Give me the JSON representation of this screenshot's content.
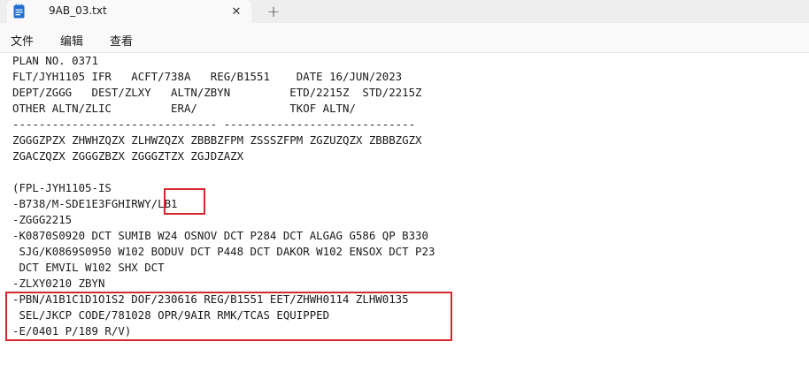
{
  "tab": {
    "title": "9AB_03.txt",
    "close_label": "✕",
    "new_tab_label": "+"
  },
  "menu": {
    "file": "文件",
    "edit": "编辑",
    "view": "查看"
  },
  "editor": {
    "lines": [
      "PLAN NO. 0371",
      "FLT/JYH1105 IFR   ACFT/738A   REG/B1551    DATE 16/JUN/2023",
      "DEPT/ZGGG   DEST/ZLXY   ALTN/ZBYN         ETD/2215Z  STD/2215Z",
      "OTHER ALTN/ZLIC         ERA/              TKOF ALTN/",
      "------------------------------- -----------------------------",
      "ZGGGZPZX ZHWHZQZX ZLHWZQZX ZBBBZFPM ZSSSZFPM ZGZUZQZX ZBBBZGZX",
      "ZGACZQZX ZGGGZBZX ZGGGZTZX ZGJDZAZX",
      "",
      "(FPL-JYH1105-IS",
      "-B738/M-SDE1E3FGHIRWY/LB1",
      "-ZGGG2215",
      "-K0870S0920 DCT SUMIB W24 OSNOV DCT P284 DCT ALGAG G586 QP B330",
      " SJG/K0869S0950 W102 BODUV DCT P448 DCT DAKOR W102 ENSOX DCT P23",
      " DCT EMVIL W102 SHX DCT",
      "-ZLXY0210 ZBYN",
      "-PBN/A1B1C1D1O1S2 DOF/230616 REG/B1551 EET/ZHWH0114 ZLHW0135",
      " SEL/JKCP CODE/781028 OPR/9AIR RMK/TCAS EQUIPPED",
      "-E/0401 P/189 R/V)"
    ]
  },
  "colors": {
    "highlight_box": "#d7282f",
    "file_icon": "#1f6fd1"
  }
}
